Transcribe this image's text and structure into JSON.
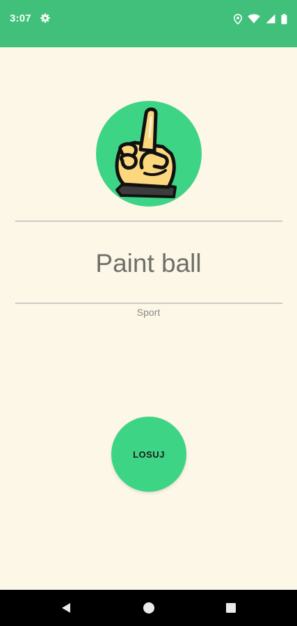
{
  "status_bar": {
    "time": "3:07",
    "icons": [
      "gear-icon",
      "location-icon",
      "wifi-icon",
      "signal-icon",
      "battery-icon"
    ],
    "background": "#40c07a"
  },
  "logo": {
    "icon": "raised-finger-hand-icon",
    "circle_color": "#3ed485"
  },
  "result": {
    "title": "Paint ball",
    "category": "Sport"
  },
  "action": {
    "draw_label": "LOSUJ",
    "color": "#3ed485"
  },
  "nav_bar": {
    "icons": [
      "back-icon",
      "home-icon",
      "recents-icon"
    ]
  },
  "colors": {
    "background": "#fcf7e6",
    "accent": "#3ed485"
  }
}
